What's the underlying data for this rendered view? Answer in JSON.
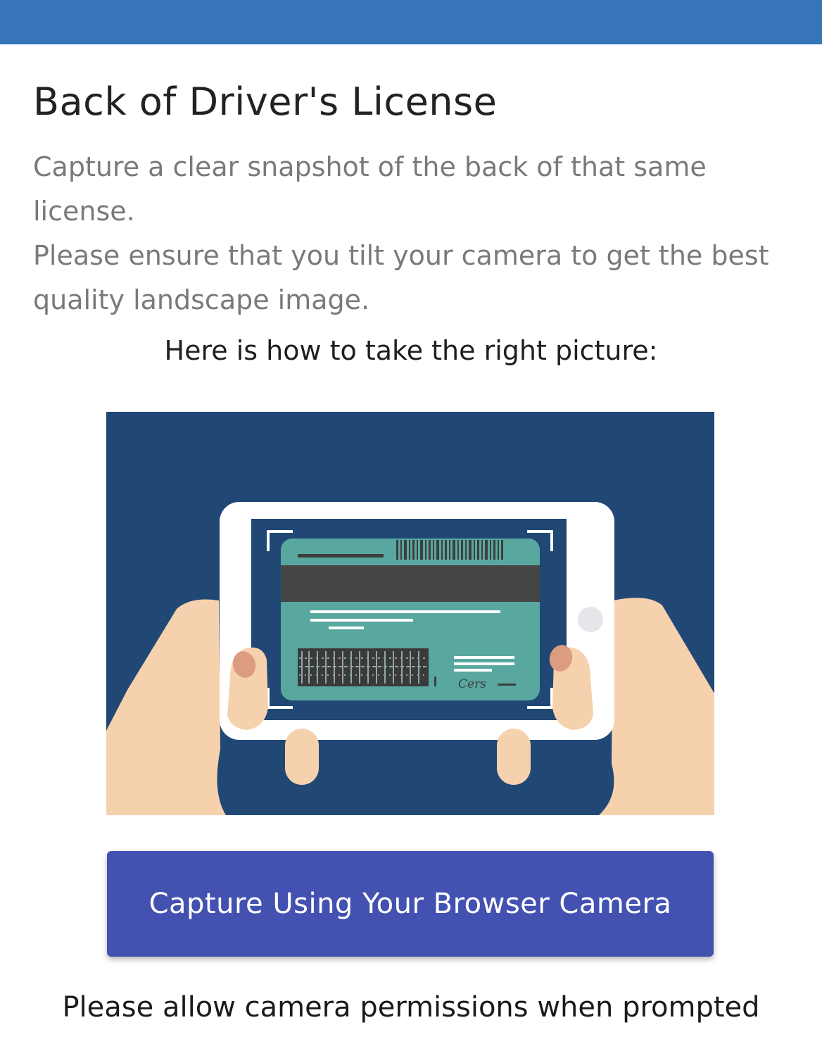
{
  "header": {
    "bar_color": "#3575b8"
  },
  "page": {
    "title": "Back of Driver's License",
    "description_line1": "Capture a clear snapshot of the back of that same license.",
    "description_line2": "Please ensure that you tilt your camera to get the best quality landscape image.",
    "howto_text": "Here is how to take the right picture:"
  },
  "illustration": {
    "subject": "hands holding phone capturing back of license",
    "signature_text": "Cers",
    "background_color": "#214874",
    "card_color": "#58a8a0",
    "skin_color": "#f6d1ad"
  },
  "actions": {
    "capture_label": "Capture Using Your Browser Camera",
    "capture_color": "#4351b1"
  },
  "footer": {
    "permission_text": "Please allow camera permissions when prompted"
  }
}
